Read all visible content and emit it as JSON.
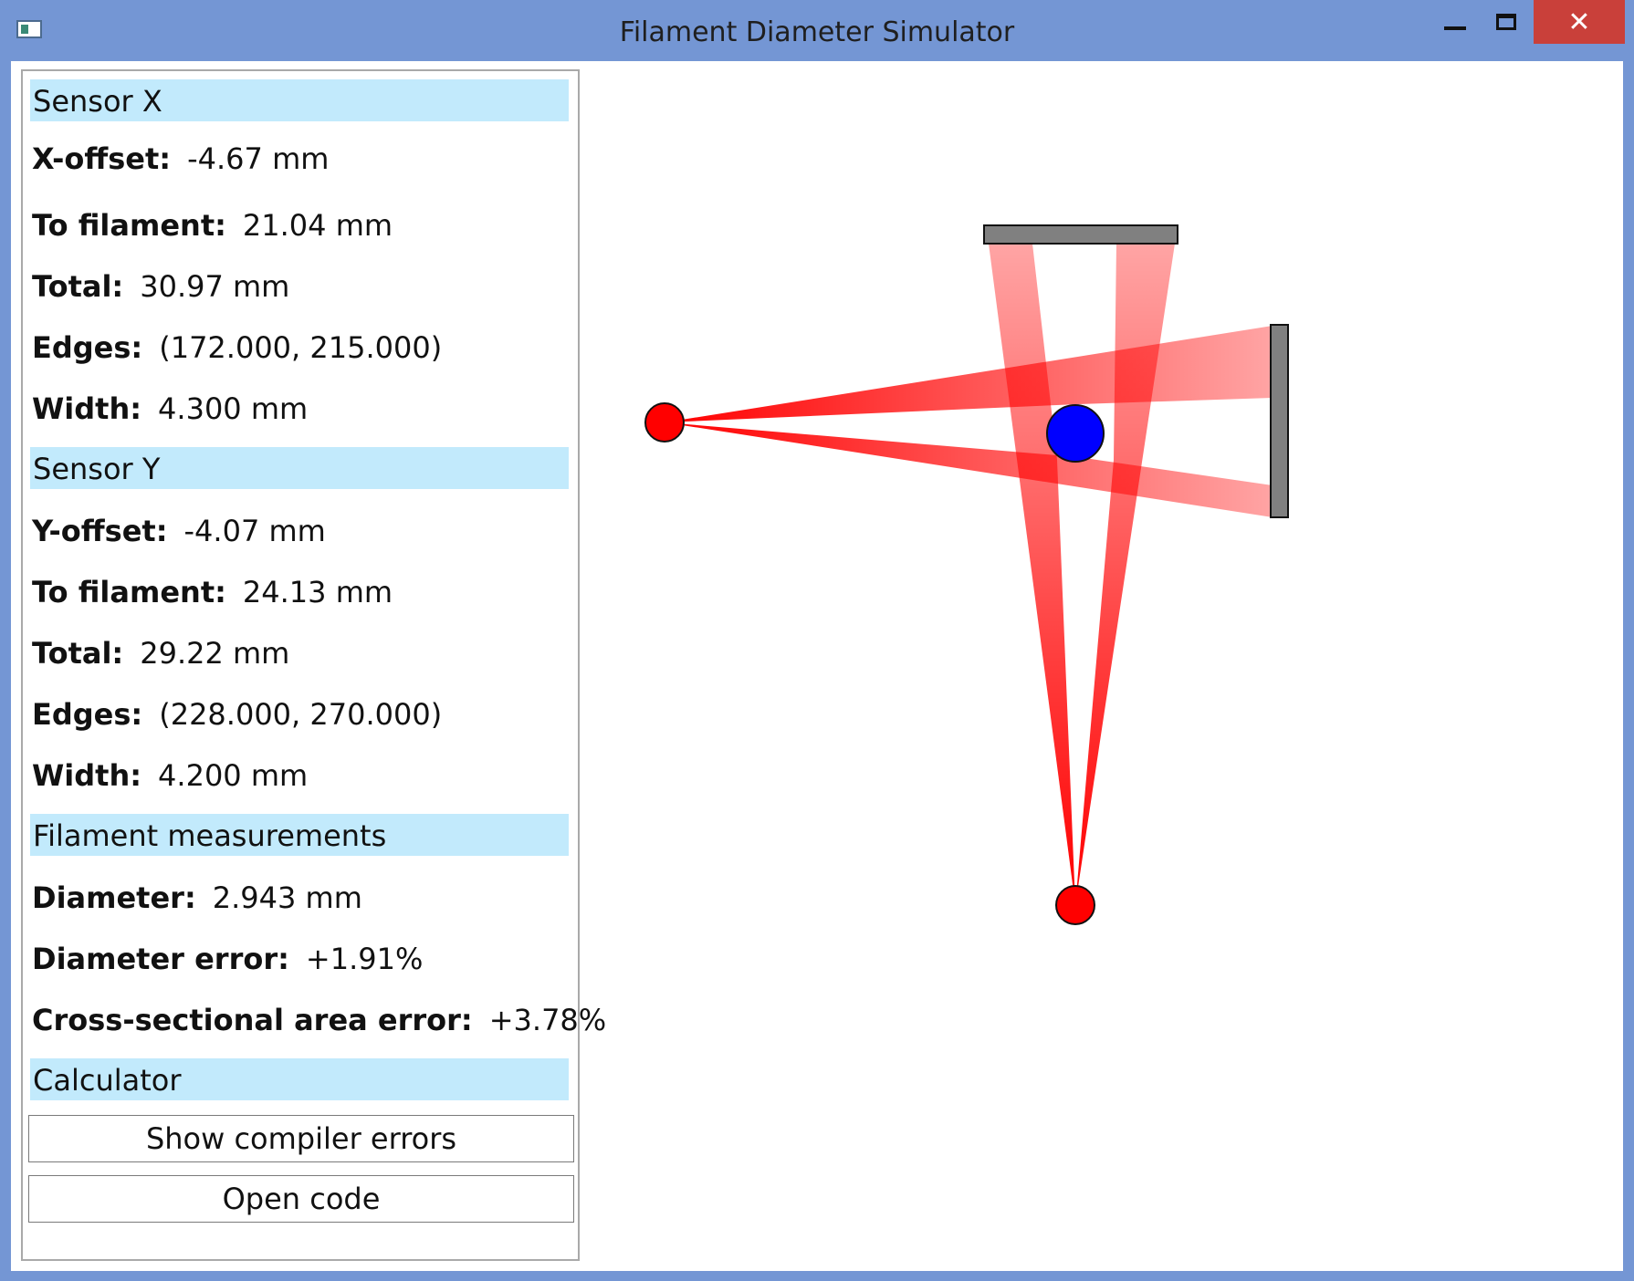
{
  "window": {
    "title": "Filament Diameter Simulator",
    "minimize_icon": "minimize-icon",
    "maximize_icon": "maximize-icon",
    "close_icon": "close-icon",
    "close_glyph": "✕"
  },
  "sensor_x": {
    "header": "Sensor X",
    "rows": [
      {
        "label": "X-offset:",
        "value": "-4.67 mm"
      },
      {
        "label": "To filament:",
        "value": "21.04 mm"
      },
      {
        "label": "Total:",
        "value": "30.97 mm"
      },
      {
        "label": "Edges:",
        "value": "(172.000, 215.000)"
      },
      {
        "label": "Width:",
        "value": "4.300 mm"
      }
    ]
  },
  "sensor_y": {
    "header": "Sensor Y",
    "rows": [
      {
        "label": "Y-offset:",
        "value": "-4.07 mm"
      },
      {
        "label": "To filament:",
        "value": "24.13 mm"
      },
      {
        "label": "Total:",
        "value": "29.22 mm"
      },
      {
        "label": "Edges:",
        "value": "(228.000, 270.000)"
      },
      {
        "label": "Width:",
        "value": "4.200 mm"
      }
    ]
  },
  "filament": {
    "header": "Filament measurements",
    "rows": [
      {
        "label": "Diameter:",
        "value": "2.943 mm"
      },
      {
        "label": "Diameter error:",
        "value": "+1.91%"
      },
      {
        "label": "Cross-sectional area error:",
        "value": "+3.78%"
      }
    ]
  },
  "calculator": {
    "header": "Calculator",
    "show_errors_label": "Show compiler errors",
    "open_code_label": "Open code"
  },
  "colors": {
    "title_bar": "#7496d4",
    "section_header": "#c2eafc",
    "light_source": "#ff0000",
    "filament": "#0000ff",
    "sensor": "#808080",
    "close_button": "#c9403a"
  }
}
